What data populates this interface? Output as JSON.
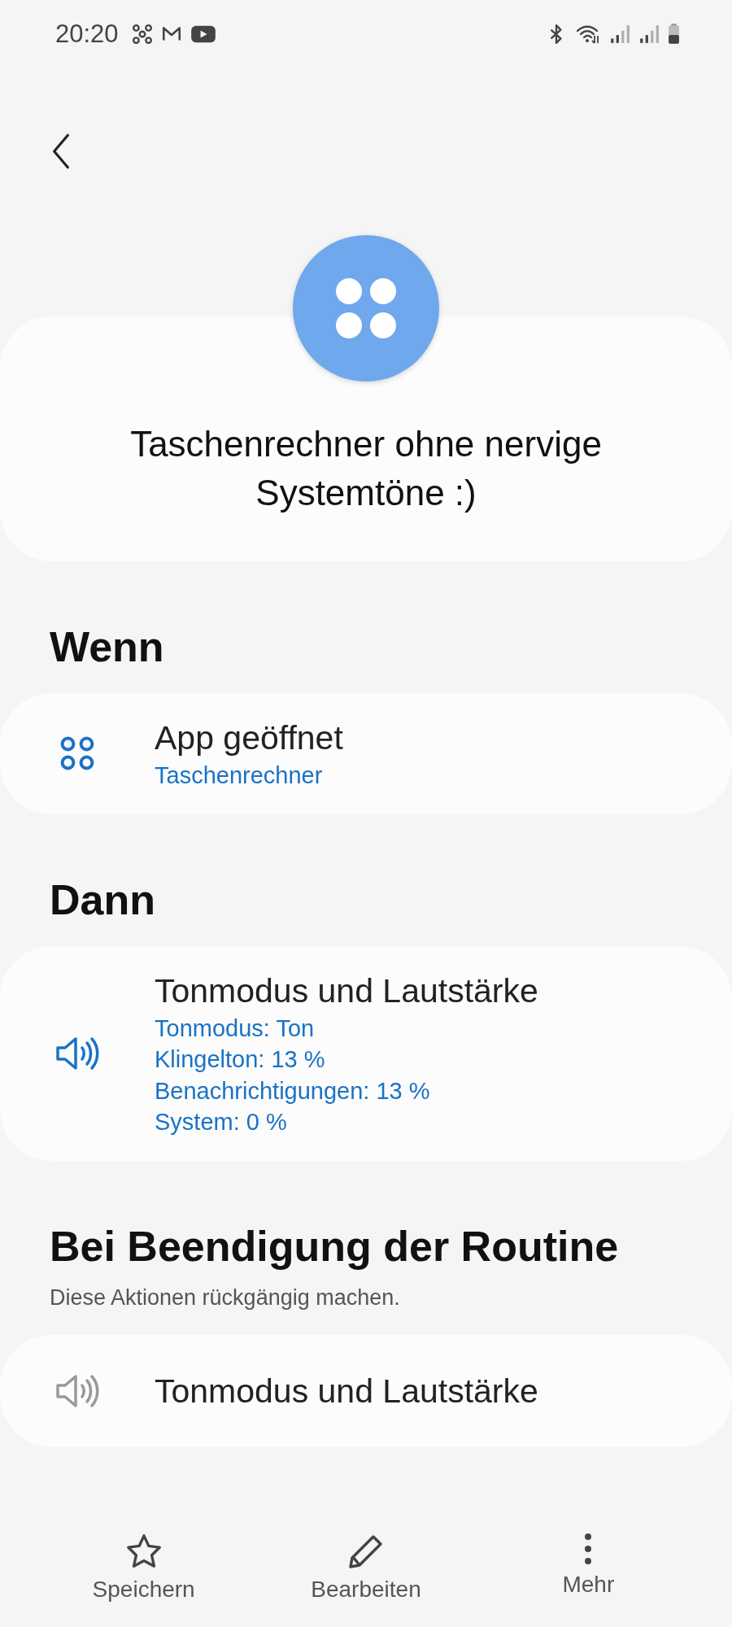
{
  "status_bar": {
    "time": "20:20"
  },
  "routine": {
    "title": "Taschenrechner ohne nervige Systemtöne :)"
  },
  "sections": [
    {
      "heading": "Wenn",
      "items": [
        {
          "kind": "app",
          "title": "App geöffnet",
          "details": [
            "Taschenrechner"
          ],
          "dimmed": false
        }
      ]
    },
    {
      "heading": "Dann",
      "items": [
        {
          "kind": "sound",
          "title": "Tonmodus und Lautstärke",
          "details": [
            "Tonmodus: Ton",
            "Klingelton: 13 %",
            "Benachrichtigungen: 13 %",
            "System: 0 %"
          ],
          "dimmed": false
        }
      ]
    },
    {
      "heading": "Bei Beendigung der Routine",
      "subtitle": "Diese Aktionen rückgängig machen.",
      "items": [
        {
          "kind": "sound",
          "title": "Tonmodus und Lautstärke",
          "dimmed": true
        }
      ]
    }
  ],
  "bottom_bar": [
    {
      "kind": "star",
      "label": "Speichern"
    },
    {
      "kind": "pencil",
      "label": "Bearbeiten"
    },
    {
      "kind": "more",
      "label": "Mehr"
    }
  ]
}
